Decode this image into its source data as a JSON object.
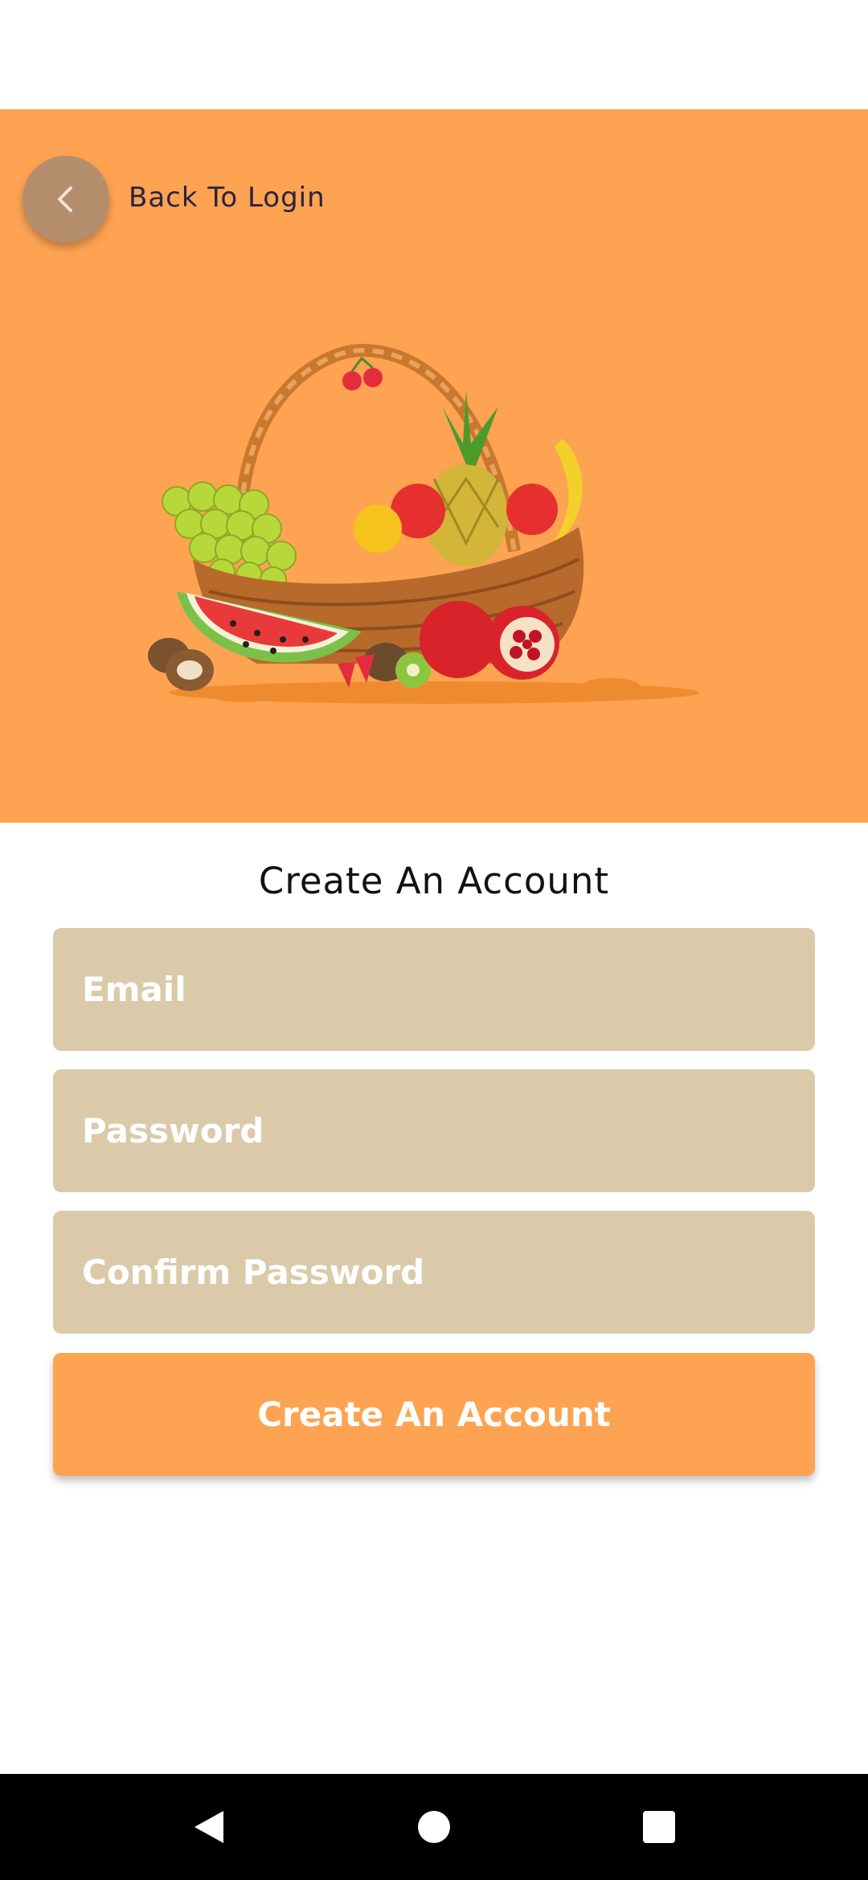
{
  "header": {
    "back_label": "Back To Login",
    "back_icon": "chevron-left-icon"
  },
  "hero": {
    "background_color": "#fda352",
    "illustration": "fruit-basket-illustration"
  },
  "form": {
    "title": "Create An Account",
    "email_placeholder": "Email",
    "email_value": "",
    "password_placeholder": "Password",
    "password_value": "",
    "confirm_password_placeholder": "Confirm Password",
    "confirm_password_value": "",
    "submit_label": "Create An Account",
    "field_color": "#dbcaa9",
    "accent_color": "#fda352"
  },
  "navigation_bar": {
    "back_icon": "triangle-back-icon",
    "home_icon": "circle-home-icon",
    "recents_icon": "square-recents-icon"
  }
}
